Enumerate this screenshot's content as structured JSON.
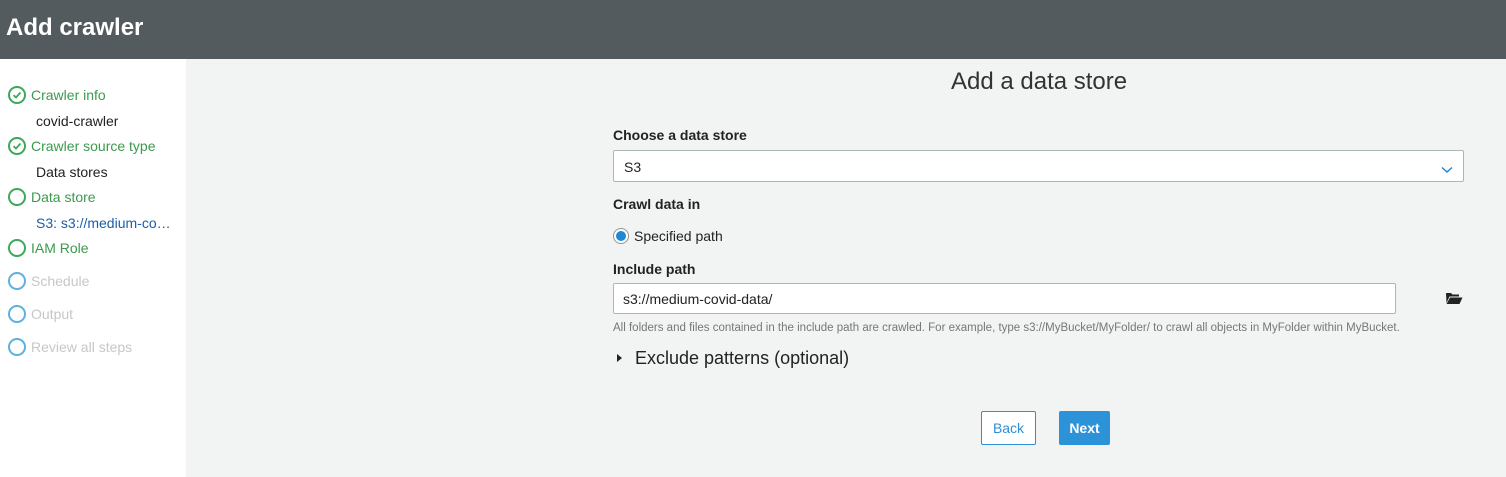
{
  "header": {
    "title": "Add crawler"
  },
  "sidebar": {
    "steps": [
      {
        "label": "Crawler info",
        "state": "done",
        "sub": "covid-crawler"
      },
      {
        "label": "Crawler source type",
        "state": "done",
        "sub": "Data stores"
      },
      {
        "label": "Data store",
        "state": "current",
        "sub": "S3: s3://medium-covid-data/"
      },
      {
        "label": "IAM Role",
        "state": "current"
      },
      {
        "label": "Schedule",
        "state": "future"
      },
      {
        "label": "Output",
        "state": "future"
      },
      {
        "label": "Review all steps",
        "state": "future"
      }
    ]
  },
  "main": {
    "title": "Add a data store",
    "data_store": {
      "label": "Choose a data store",
      "value": "S3"
    },
    "crawl": {
      "label": "Crawl data in",
      "option": "Specified path",
      "selected": true
    },
    "include_path": {
      "label": "Include path",
      "value": "s3://medium-covid-data/",
      "hint": "All folders and files contained in the include path are crawled. For example, type s3://MyBucket/MyFolder/ to crawl all objects in MyFolder within MyBucket."
    },
    "exclude": {
      "label": "Exclude patterns (optional)"
    },
    "buttons": {
      "back": "Back",
      "next": "Next"
    }
  },
  "colors": {
    "header_bg": "#545b5e",
    "done_green": "#3b9a4d",
    "link_blue": "#1a5fa8",
    "future_blue": "#5fb0df",
    "primary_button": "#2d93d8"
  },
  "icons": {
    "done": "check-circle-icon",
    "current": "circle-outline-icon",
    "future": "circle-outline-icon",
    "select": "chevron-down-icon",
    "browse": "folder-open-icon",
    "exclude": "caret-right-icon"
  }
}
